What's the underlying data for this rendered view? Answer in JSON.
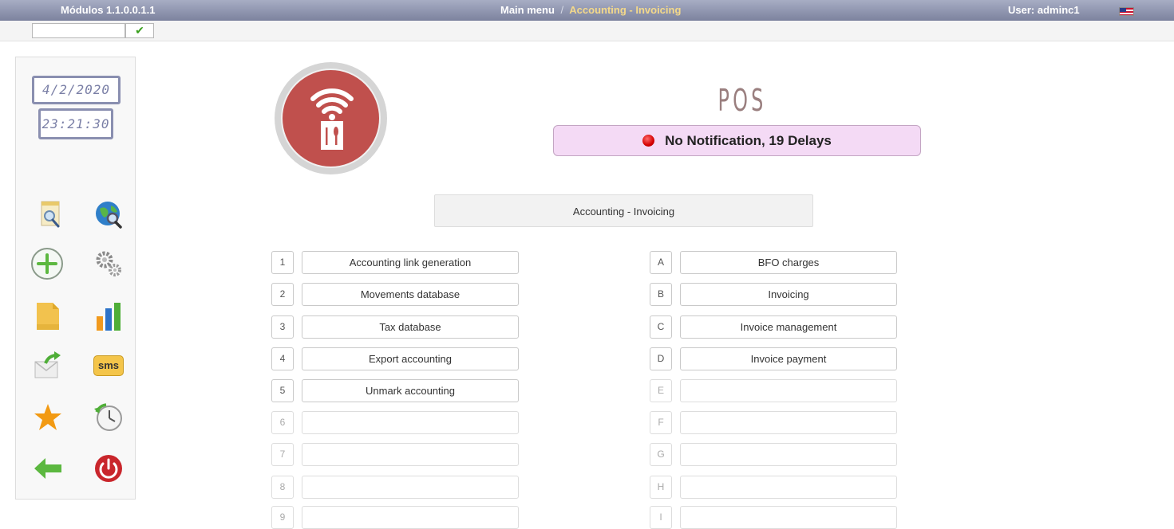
{
  "header": {
    "modules_label": "Módulos 1.1.0.0.1.1",
    "breadcrumb_root": "Main menu",
    "breadcrumb_separator": "/",
    "breadcrumb_current": "Accounting - Invoicing",
    "user_label": "User: adminc1",
    "language_flag": "us-flag-icon"
  },
  "quick_search": {
    "value": "",
    "button_icon": "checkmark-icon",
    "button_glyph": "✔"
  },
  "sidebar": {
    "date": "4/2/2020",
    "time": "23:21:30",
    "icons": [
      "document-search-icon",
      "globe-search-icon",
      "add-circle-icon",
      "gears-icon",
      "folder-icon",
      "bar-chart-icon",
      "mail-forward-icon",
      "sms-icon",
      "star-icon",
      "clock-history-icon",
      "back-arrow-icon",
      "power-icon"
    ],
    "sms_text": "sms"
  },
  "main": {
    "app_title": "POS",
    "notification_text": "No Notification, 19 Delays",
    "notification_color": "#d40000",
    "section_title": "Accounting - Invoicing",
    "left_menu": [
      {
        "key": "1",
        "label": "Accounting link generation"
      },
      {
        "key": "2",
        "label": "Movements database"
      },
      {
        "key": "3",
        "label": "Tax database"
      },
      {
        "key": "4",
        "label": "Export accounting"
      },
      {
        "key": "5",
        "label": "Unmark accounting"
      },
      {
        "key": "6",
        "label": ""
      },
      {
        "key": "7",
        "label": ""
      },
      {
        "key": "8",
        "label": ""
      },
      {
        "key": "9",
        "label": ""
      }
    ],
    "right_menu": [
      {
        "key": "A",
        "label": "BFO charges"
      },
      {
        "key": "B",
        "label": "Invoicing"
      },
      {
        "key": "C",
        "label": "Invoice management"
      },
      {
        "key": "D",
        "label": "Invoice payment"
      },
      {
        "key": "E",
        "label": ""
      },
      {
        "key": "F",
        "label": ""
      },
      {
        "key": "G",
        "label": ""
      },
      {
        "key": "H",
        "label": ""
      },
      {
        "key": "I",
        "label": ""
      }
    ]
  },
  "colors": {
    "topbar": "#8f95b0",
    "accent_text": "#f4d98a",
    "logo_red": "#c0504d",
    "notification_bg": "#f4daf5"
  }
}
